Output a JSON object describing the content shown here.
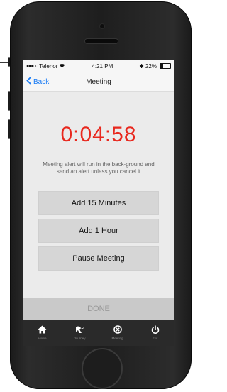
{
  "status_bar": {
    "carrier": "Telenor",
    "signal_dots": "●●●○○",
    "time": "4:21 PM",
    "battery_percent": "22%"
  },
  "nav": {
    "back_label": "Back",
    "title": "Meeting"
  },
  "timer": {
    "value": "0:04:58",
    "color": "#e8281e"
  },
  "note": "Meeting alert will run in the back-ground and send an alert unless you cancel it",
  "actions": [
    {
      "label": "Add 15 Minutes"
    },
    {
      "label": "Add 1 Hour"
    },
    {
      "label": "Pause Meeting"
    }
  ],
  "done_label": "DONE",
  "tabs": [
    {
      "label": "Home",
      "icon": "home-icon"
    },
    {
      "label": "Journey",
      "icon": "journey-icon"
    },
    {
      "label": "Meeting",
      "icon": "meeting-icon"
    },
    {
      "label": "Exit",
      "icon": "power-icon"
    }
  ],
  "colors": {
    "accent": "#1a7cf5",
    "tabbar": "#2a2a2a"
  }
}
